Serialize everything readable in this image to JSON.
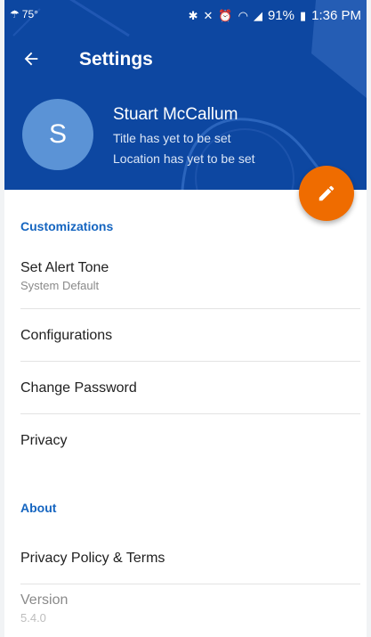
{
  "status_bar": {
    "temperature": "75°",
    "battery": "91%",
    "time": "1:36 PM"
  },
  "toolbar": {
    "title": "Settings"
  },
  "profile": {
    "initial": "S",
    "name": "Stuart McCallum",
    "title_text": "Title has yet to be set",
    "location_text": "Location has yet to be set"
  },
  "sections": {
    "customizations": {
      "heading": "Customizations",
      "items": [
        {
          "label": "Set Alert Tone",
          "sub": "System Default"
        },
        {
          "label": "Configurations"
        },
        {
          "label": "Change Password"
        },
        {
          "label": "Privacy"
        }
      ]
    },
    "about": {
      "heading": "About",
      "items": [
        {
          "label": "Privacy Policy & Terms"
        },
        {
          "label": "Version",
          "sub": "5.4.0"
        }
      ]
    }
  },
  "colors": {
    "header": "#0d47a1",
    "accent": "#1565c0",
    "fab": "#ef6c00",
    "avatar": "#5b93d6"
  },
  "icons": {
    "back": "arrow-left-icon",
    "fab": "pencil-icon"
  }
}
